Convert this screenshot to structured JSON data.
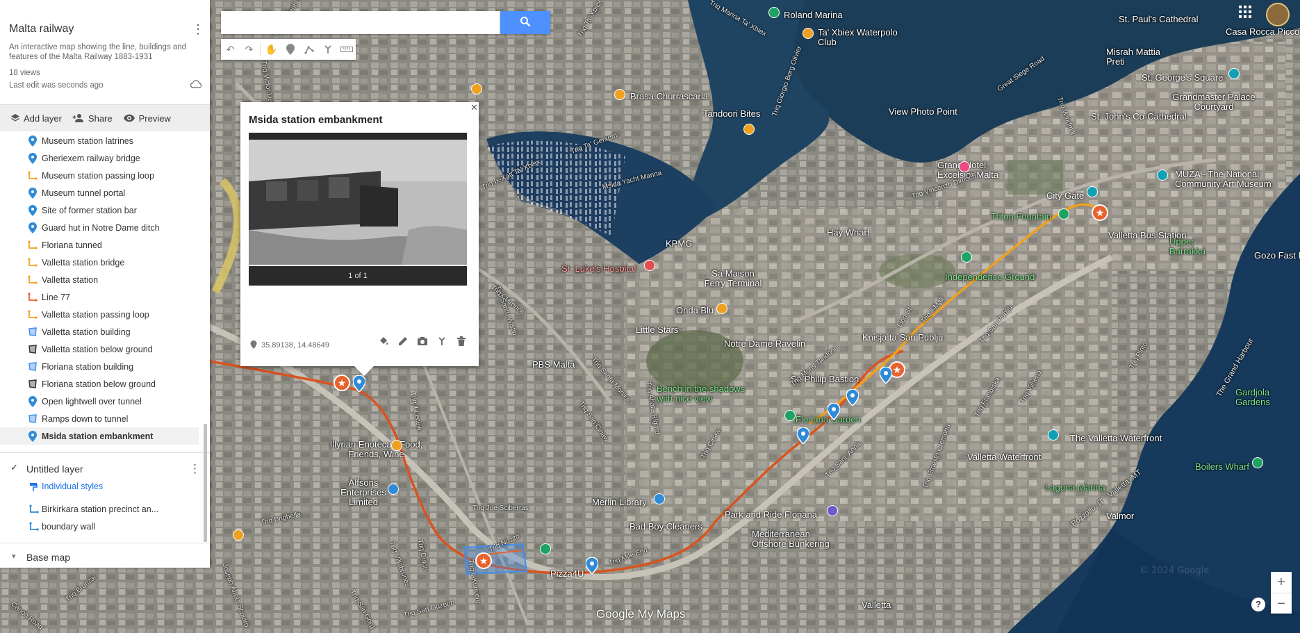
{
  "map": {
    "title": "Malta railway",
    "description": "An interactive map showing the line, buildings and features of the Malta Railway 1883-1931",
    "views": "18 views",
    "last_edit": "Last edit was seconds ago"
  },
  "actions": {
    "add_layer": "Add layer",
    "share": "Share",
    "preview": "Preview"
  },
  "features": [
    {
      "label": "Museum station latrines",
      "icon": "pin-icon"
    },
    {
      "label": "Gheriexem railway bridge",
      "icon": "pin-icon"
    },
    {
      "label": "Museum station passing loop",
      "icon": "line-icon"
    },
    {
      "label": "Museum tunnel portal",
      "icon": "pin-icon"
    },
    {
      "label": "Site of former station bar",
      "icon": "pin-icon"
    },
    {
      "label": "Guard hut in Notre Dame ditch",
      "icon": "pin-icon"
    },
    {
      "label": "Floriana tunned",
      "icon": "line-icon"
    },
    {
      "label": "Valletta station bridge",
      "icon": "line-icon"
    },
    {
      "label": "Valletta station",
      "icon": "line-icon"
    },
    {
      "label": "Line 77",
      "icon": "line-icon"
    },
    {
      "label": "Valletta station passing loop",
      "icon": "line-icon"
    },
    {
      "label": "Valletta station building",
      "icon": "polygon-icon"
    },
    {
      "label": "Valletta station below ground",
      "icon": "polygon-dark-icon"
    },
    {
      "label": "Floriana station building",
      "icon": "polygon-icon"
    },
    {
      "label": "Floriana station below ground",
      "icon": "polygon-dark-icon"
    },
    {
      "label": "Open lightwell over tunnel",
      "icon": "pin-icon"
    },
    {
      "label": "Ramps down to tunnel",
      "icon": "polygon-icon"
    },
    {
      "label": "Msida station embankment",
      "icon": "pin-icon",
      "selected": true
    }
  ],
  "layer2": {
    "title": "Untitled layer",
    "styles": "Individual styles",
    "items": [
      "Birkirkara station precinct an...",
      "boundary wall"
    ]
  },
  "basemap": {
    "label": "Base map"
  },
  "search": {
    "placeholder": "",
    "value": ""
  },
  "popup": {
    "title": "Msida station embankment",
    "pager": "1 of 1",
    "coords": "35.89138, 14.48649"
  },
  "brand": "Google My Maps",
  "colors": {
    "accent": "#4d90fe",
    "route_red": "#d9531e",
    "route_orange": "#f0a020",
    "pin_blue": "#2f8bd8",
    "star_orange": "#e8622d"
  },
  "place_labels": [
    {
      "text": "Roland Marina",
      "style": "white"
    },
    {
      "text": "Ta' Xbiex Waterpolo Club",
      "style": "white"
    },
    {
      "text": "St. Paul's Cathedral",
      "style": "white"
    },
    {
      "text": "Casa Rocca Picco",
      "style": "white"
    },
    {
      "text": "Misrah Mattia Preti",
      "style": "white"
    },
    {
      "text": "St. George's Square",
      "style": "white"
    },
    {
      "text": "Grandmaster Palace Courtyard",
      "style": "white"
    },
    {
      "text": "St. John's Co-Cathedral",
      "style": "white"
    },
    {
      "text": "Brasa Churrascaria",
      "style": "white"
    },
    {
      "text": "Tandoori Bites",
      "style": "white"
    },
    {
      "text": "View Photo Point",
      "style": "white"
    },
    {
      "text": "Grand Hotel Excelsior Malta",
      "style": "white"
    },
    {
      "text": "MUŻA - The National Community Art Museum",
      "style": "white"
    },
    {
      "text": "City Gate",
      "style": "white"
    },
    {
      "text": "Triton Fountain",
      "style": "green"
    },
    {
      "text": "Valletta Bus Station",
      "style": "white"
    },
    {
      "text": "Upper Barrakka",
      "style": "green"
    },
    {
      "text": "Gozo Fast F",
      "style": "white"
    },
    {
      "text": "Hay Wharf",
      "style": "white"
    },
    {
      "text": "KPMG",
      "style": "white"
    },
    {
      "text": "St. Luke's Hospital",
      "style": "pink"
    },
    {
      "text": "Sa Maison Ferry Terminal",
      "style": "white"
    },
    {
      "text": "Independence Ground",
      "style": "green"
    },
    {
      "text": "Onda Blu",
      "style": "white"
    },
    {
      "text": "Little Stars",
      "style": "white"
    },
    {
      "text": "Notre Dame Ravelin",
      "style": "white"
    },
    {
      "text": "Knisja ta San Publju",
      "style": "white"
    },
    {
      "text": "PBS Malta",
      "style": "white"
    },
    {
      "text": "St. Philip Bastion",
      "style": "white"
    },
    {
      "text": "Bench in the shadows with nice view",
      "style": "green"
    },
    {
      "text": "Floriana Garden",
      "style": "green"
    },
    {
      "text": "Gardjola Gardens",
      "style": "green"
    },
    {
      "text": "The Valletta Waterfront",
      "style": "white"
    },
    {
      "text": "Valletta Waterfront",
      "style": "white"
    },
    {
      "text": "Laguna Marina",
      "style": "green"
    },
    {
      "text": "Boilers Wharf",
      "style": "green"
    },
    {
      "text": "Illyrian Enoteca - Food, Friends, Wine",
      "style": "white"
    },
    {
      "text": "Alfsons Enterprises Limited",
      "style": "white"
    },
    {
      "text": "Merlin Library",
      "style": "white"
    },
    {
      "text": "Bad Boy Cleaners",
      "style": "white"
    },
    {
      "text": "Park and Ride Floriana",
      "style": "white"
    },
    {
      "text": "Mediterranean Offshore Bunkering",
      "style": "white"
    },
    {
      "text": "Valmor",
      "style": "white"
    },
    {
      "text": "Valletta",
      "style": "white"
    },
    {
      "text": "Pizza4U",
      "style": "white"
    },
    {
      "text": "Msida Yacht Marina",
      "style": "white"
    },
    {
      "text": "The Grand Harbour",
      "style": "white"
    },
    {
      "text": "Pozzallo, IT - Valletta, MT",
      "style": "white"
    }
  ],
  "street_labels": [
    "Triq Joe Sciberras",
    "Triq Mile End",
    "Triq Nuzzo",
    "Triq Brighella",
    "Triq il-Kunvent",
    "Triq Villabrunes",
    "Triq San Ciriaw",
    "Triq Santa Monika",
    "Triq Santu Wistin",
    "Triq Clarence",
    "Triq Vincenzo Dimech",
    "Triq Ix-Xatt Ta' Xbiex",
    "Triq Abate Rigord",
    "Triq il-Mall",
    "Triq San Publju",
    "Triq Ciriaw",
    "Triq Sant' Anna",
    "Triq Ernesto Cremona",
    "Triq il-Lecew",
    "Triq Giovanni Bonello",
    "Triq Victor Denaro",
    "Triq Ta' Xbiex",
    "Triq Marina Ta' Xbiex",
    "Triq Ta' Gerxem",
    "Triq Duluri",
    "Lion St",
    "Triq Giorgio Borg Olivier",
    "Triq Mons Tandoori",
    "Great Siege Road",
    "Triq Windmill",
    "Triq Pinto",
    "Triq Frangiska",
    "Triq Vilhena",
    "Joseph Abela Scolaro",
    "Triq San Gorg",
    "Canon Road",
    "Triq Brunzar",
    "Triq San Guzepp"
  ]
}
